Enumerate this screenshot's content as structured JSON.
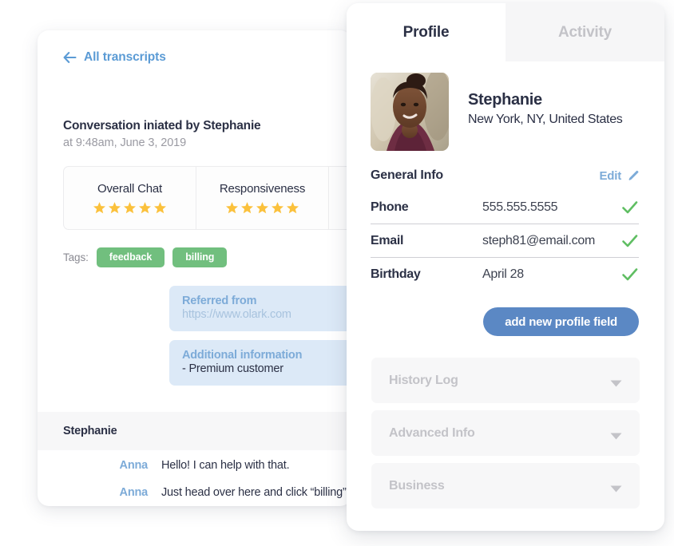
{
  "transcript": {
    "back_link": "All transcripts",
    "back_icon": "arrow-left-icon",
    "conversation_title": "Conversation iniated by Stephanie",
    "conversation_time": "at 9:48am, June 3, 2019",
    "ratings": [
      {
        "label": "Overall Chat",
        "stars": 5
      },
      {
        "label": "Responsiveness",
        "stars": 5
      },
      {
        "label": "",
        "stars": 0
      }
    ],
    "tags_label": "Tags:",
    "tags": [
      "feedback",
      "billing"
    ],
    "tag_color": "#71bf7e",
    "info_boxes": [
      {
        "title": "Referred from",
        "body": "https://www.olark.com",
        "body_style": "muted"
      },
      {
        "title": "Additional information",
        "body": "- Premium customer",
        "body_style": "dark"
      }
    ],
    "speaker": "Stephanie",
    "messages": [
      {
        "author": "Anna",
        "text": "Hello! I can help with that."
      },
      {
        "author": "Anna",
        "text": "Just head over here and click “billing”"
      }
    ]
  },
  "profile": {
    "tabs": [
      {
        "label": "Profile",
        "active": true
      },
      {
        "label": "Activity",
        "active": false
      }
    ],
    "avatar_alt": "avatar-photo",
    "name": "Stephanie",
    "location": "New York, NY, United States",
    "general_info": {
      "title": "General Info",
      "edit_label": "Edit",
      "edit_icon": "pencil-icon",
      "fields": [
        {
          "key": "Phone",
          "value": "555.555.5555",
          "verified": true
        },
        {
          "key": "Email",
          "value": "steph81@email.com",
          "verified": true
        },
        {
          "key": "Birthday",
          "value": "April 28",
          "verified": true
        }
      ],
      "verified_icon": "check-icon",
      "verified_color": "#5fbe62"
    },
    "add_field_button": "add new profile field",
    "accent_button_color": "#5b88c4",
    "accordions": [
      {
        "label": "History Log",
        "icon": "chevron-down-icon"
      },
      {
        "label": "Advanced Info",
        "icon": "chevron-down-icon"
      },
      {
        "label": "Business",
        "icon": "chevron-down-icon"
      }
    ]
  }
}
